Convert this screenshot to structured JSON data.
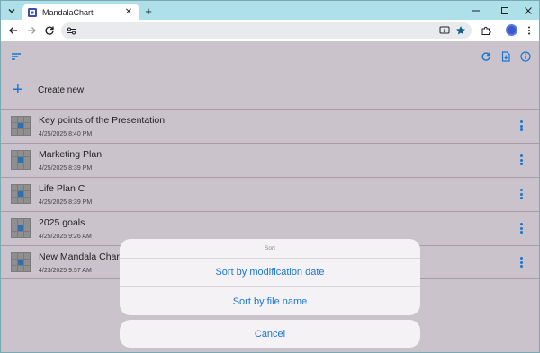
{
  "browser": {
    "tab_title": "MandalaChart",
    "tab_close_glyph": "✕",
    "new_tab_glyph": "+"
  },
  "app": {
    "create_new_label": "Create new",
    "create_icon_glyph": "+",
    "accent_color": "#1976d2",
    "charts": [
      {
        "title": "Key points of the Presentation",
        "date": "4/25/2025 8:40 PM"
      },
      {
        "title": "Marketing Plan",
        "date": "4/25/2025 8:39 PM"
      },
      {
        "title": "Life Plan C",
        "date": "4/25/2025 8:39 PM"
      },
      {
        "title": "2025 goals",
        "date": "4/25/2025 9:26 AM"
      },
      {
        "title": "New Mandala Chart",
        "date": "4/23/2025 9:57 AM"
      }
    ]
  },
  "sort_sheet": {
    "title": "Sort",
    "options": [
      "Sort by modification date",
      "Sort by file name"
    ],
    "cancel_label": "Cancel"
  }
}
